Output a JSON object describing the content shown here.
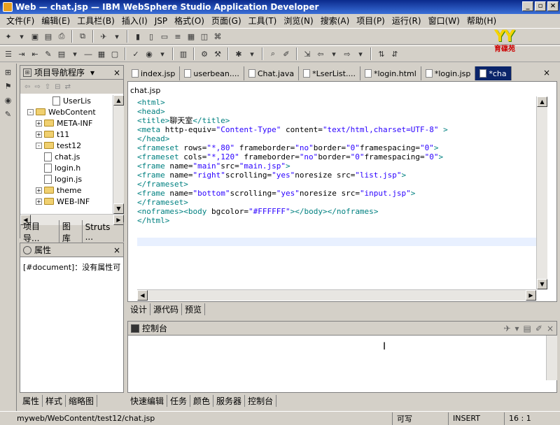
{
  "window": {
    "title": "Web — chat.jsp — IBM WebSphere Studio Application Developer"
  },
  "menu": [
    "文件(F)",
    "编辑(E)",
    "工具栏(B)",
    "插入(I)",
    "JSP",
    "格式(O)",
    "页面(G)",
    "工具(T)",
    "浏览(N)",
    "搜索(A)",
    "项目(P)",
    "运行(R)",
    "窗口(W)",
    "帮助(H)"
  ],
  "logo": {
    "mark": "YY",
    "subtitle": "育碟苑"
  },
  "navigator": {
    "title": "项目导航程序",
    "rows": [
      {
        "label": "UserLis",
        "indent": 5,
        "kind": "file"
      },
      {
        "label": "WebContent",
        "indent": 2,
        "kind": "folder",
        "twisty": "-"
      },
      {
        "label": "META-INF",
        "indent": 3,
        "kind": "folder",
        "twisty": "+"
      },
      {
        "label": "t11",
        "indent": 3,
        "kind": "folder",
        "twisty": "+"
      },
      {
        "label": "test12",
        "indent": 3,
        "kind": "folder",
        "twisty": "-"
      },
      {
        "label": "chat.js",
        "indent": 4,
        "kind": "file"
      },
      {
        "label": "login.h",
        "indent": 4,
        "kind": "file"
      },
      {
        "label": "login.js",
        "indent": 4,
        "kind": "file"
      },
      {
        "label": "theme",
        "indent": 3,
        "kind": "folder",
        "twisty": "+"
      },
      {
        "label": "WEB-INF",
        "indent": 3,
        "kind": "folder",
        "twisty": "+"
      }
    ],
    "tabs": [
      "项目导...",
      "图库",
      "Struts ..."
    ]
  },
  "properties": {
    "title": "属性",
    "content": "[#document]：没有属性可"
  },
  "left_bottom_tabs": [
    "属性",
    "样式",
    "缩略图"
  ],
  "editor": {
    "tabs": [
      {
        "label": "index.jsp",
        "active": false
      },
      {
        "label": "userbean....",
        "active": false
      },
      {
        "label": "Chat.java",
        "active": false
      },
      {
        "label": "*LserList....",
        "active": false
      },
      {
        "label": "*login.html",
        "active": false
      },
      {
        "label": "*login.jsp",
        "active": false
      },
      {
        "label": "*cha",
        "active": true
      }
    ],
    "file_label": "chat.jsp",
    "lines": [
      "<html>",
      "<head>",
      "<title>聊天室</title>",
      "<meta http-equiv=\"Content-Type\" content=\"text/html,charset=UTF-8\" >",
      "</head>",
      "<frameset rows=\"*,80\" frameborder=\"no\"border=\"0\"framespacing=\"0\">",
      "<frameset cols=\"*,120\" frameborder=\"no\"border=\"0\"framespacing=\"0\">",
      "<frame name=\"main\"src=\"main.jsp\">",
      "<frame name=\"right\"scrolling=\"yes\"noresize src=\"list.jsp\">",
      "</frameset>",
      "<frame name=\"bottom\"scrolling=\"yes\"noresize src=\"input.jsp\">",
      "</frameset>",
      "<noframes><body bgcolor=\"#FFFFFF\"></body></noframes>",
      "</html>"
    ],
    "view_tabs": [
      "设计",
      "源代码",
      "预览"
    ]
  },
  "console": {
    "title": "控制台"
  },
  "console_tabs": [
    "快速编辑",
    "任务",
    "颜色",
    "服务器",
    "控制台"
  ],
  "status": {
    "path": "myweb/WebContent/test12/chat.jsp",
    "mode": "可写",
    "insert": "INSERT",
    "position": "16 : 1"
  }
}
